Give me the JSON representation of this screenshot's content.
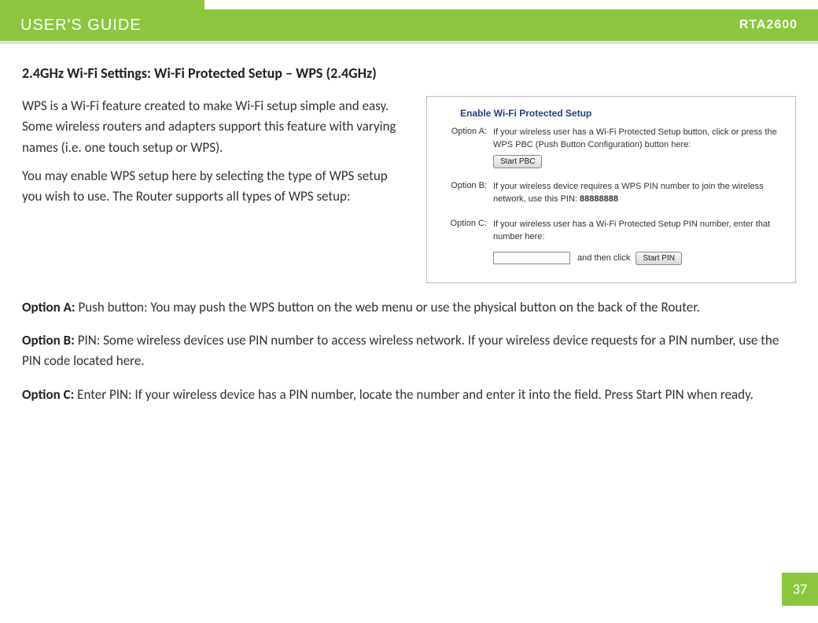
{
  "header": {
    "title": "USER'S GUIDE",
    "model": "RTA2600"
  },
  "section_title": "2.4GHz Wi-Fi Settings: Wi-Fi Protected Setup – WPS (2.4GHz)",
  "intro": {
    "p1": "WPS is a Wi-Fi feature created to make Wi-Fi setup simple and easy.  Some wireless routers and adapters support this feature with varying names (i.e. one touch setup or WPS).",
    "p2": "You may enable WPS setup here by selecting the type of WPS setup you wish to use.  The Router supports all types of WPS setup:"
  },
  "screenshot": {
    "title": "Enable Wi-Fi Protected Setup",
    "optionA": {
      "label": "Option A:",
      "text": "If your wireless user has a Wi-Fi Protected Setup button, click or press the WPS PBC (Push Button Configuration) button here:",
      "button": "Start PBC"
    },
    "optionB": {
      "label": "Option B:",
      "text_prefix": "If your wireless device requires a WPS PIN number to join the wireless network, use this PIN: ",
      "pin": "88888888"
    },
    "optionC": {
      "label": "Option C:",
      "text": "If your wireless user has a Wi-Fi Protected Setup PIN number, enter that number here:",
      "and_then": " and then click ",
      "button": "Start PIN"
    }
  },
  "options": {
    "a_label": "Option A: ",
    "a_text": "Push button: You may push the WPS button on the web menu or use the physical button on the back of the Router.",
    "b_label": "Option B: ",
    "b_text": "PIN: Some wireless devices use PIN number to access wireless network.  If your wireless device requests for a PIN number, use the PIN code located here.",
    "c_label": "Option C: ",
    "c_text": "Enter PIN: If your wireless device has a PIN number, locate the number and enter it into the field.  Press Start PIN when ready."
  },
  "page_number": "37"
}
